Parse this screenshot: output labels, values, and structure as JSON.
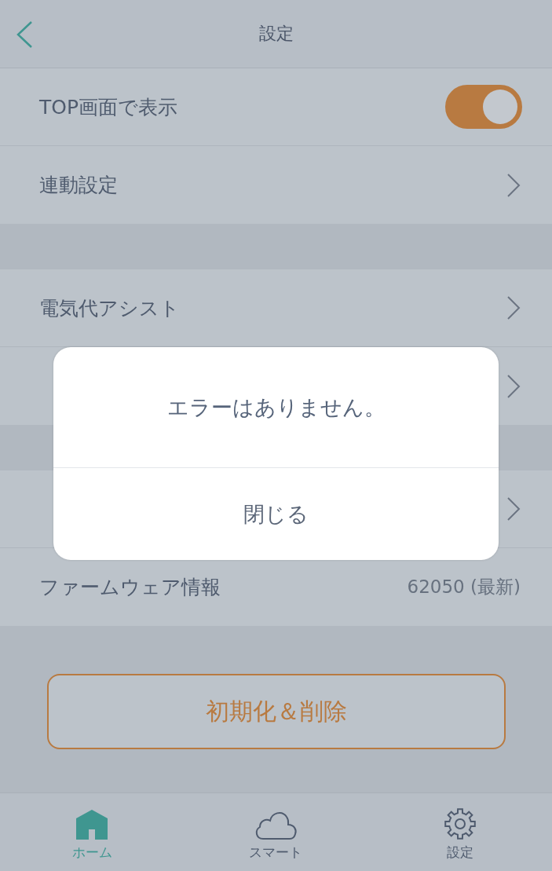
{
  "header": {
    "title": "設定"
  },
  "sections": [
    [
      {
        "kind": "toggle",
        "label": "TOP画面で表示",
        "on": true
      },
      {
        "kind": "link",
        "label": "連動設定"
      }
    ],
    [
      {
        "kind": "link",
        "label": "電気代アシスト"
      },
      {
        "kind": "link"
      }
    ],
    [
      {
        "kind": "link"
      },
      {
        "kind": "value",
        "label": "ファームウェア情報",
        "value": "62050 (最新)"
      }
    ]
  ],
  "reset_button": "初期化＆削除",
  "dialog": {
    "message": "エラーはありません。",
    "button": "閉じる"
  },
  "tabs": [
    {
      "label": "ホーム",
      "kind": "home",
      "selected": true
    },
    {
      "label": "スマート",
      "kind": "cloud",
      "selected": false
    },
    {
      "label": "設定",
      "kind": "gear",
      "selected": false
    }
  ]
}
